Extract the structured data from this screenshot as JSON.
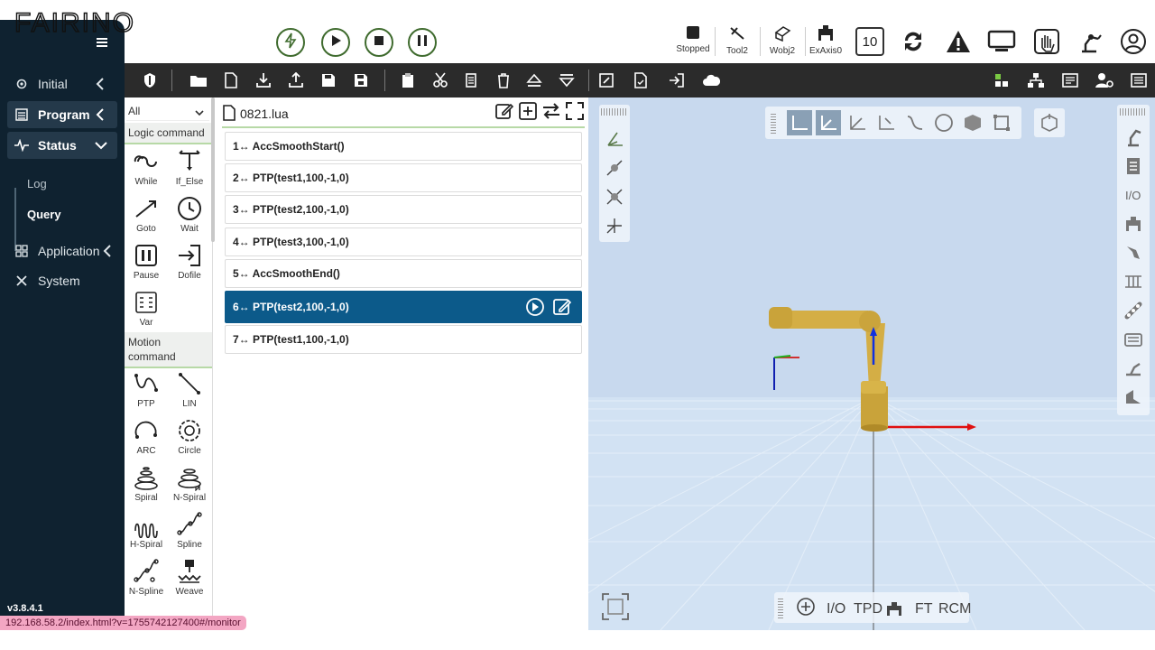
{
  "app": {
    "brand": "FAIRINO",
    "version": "v3.8.4.1",
    "url_status": "192.168.58.2/index.html?v=1755742127400#/monitor"
  },
  "sidebar": {
    "items": [
      {
        "label": "Initial",
        "icon": "gear-icon"
      },
      {
        "label": "Program",
        "icon": "list-icon"
      },
      {
        "label": "Status",
        "icon": "pulse-icon"
      },
      {
        "label": "Application",
        "icon": "grid-icon"
      },
      {
        "label": "System",
        "icon": "tools-icon"
      }
    ],
    "status_sub": [
      "Log",
      "Query"
    ]
  },
  "header": {
    "state_label": "Stopped",
    "tool_label": "Tool2",
    "wobj_label": "Wobj2",
    "exaxis_label": "ExAxis0",
    "speed_value": "10"
  },
  "palette": {
    "filter_value": "All",
    "logic_title": "Logic command",
    "logic": [
      "While",
      "If_Else",
      "Goto",
      "Wait",
      "Pause",
      "Dofile",
      "Var"
    ],
    "motion_title": "Motion command",
    "motion": [
      "PTP",
      "LIN",
      "ARC",
      "Circle",
      "Spiral",
      "N-Spiral",
      "H-Spiral",
      "Spline",
      "N-Spline",
      "Weave"
    ]
  },
  "editor": {
    "file_name": "0821.lua",
    "lines": [
      "1↔ AccSmoothStart()",
      "2↔ PTP(test1,100,-1,0)",
      "3↔ PTP(test2,100,-1,0)",
      "4↔ PTP(test3,100,-1,0)",
      "5↔ AccSmoothEnd()",
      "6↔ PTP(test2,100,-1,0)",
      "7↔ PTP(test1,100,-1,0)"
    ],
    "selected_line": 6
  },
  "view3d": {
    "bottom_bar": [
      "I/O",
      "TPD",
      "FT",
      "RCM"
    ]
  },
  "colors": {
    "sidebar_bg": "#0f2230",
    "toolbar_bg": "#2b2b2b",
    "selected_line": "#0c5a8a",
    "accent_green": "#3f6b2e",
    "view_bg": "#c8d9ee"
  }
}
